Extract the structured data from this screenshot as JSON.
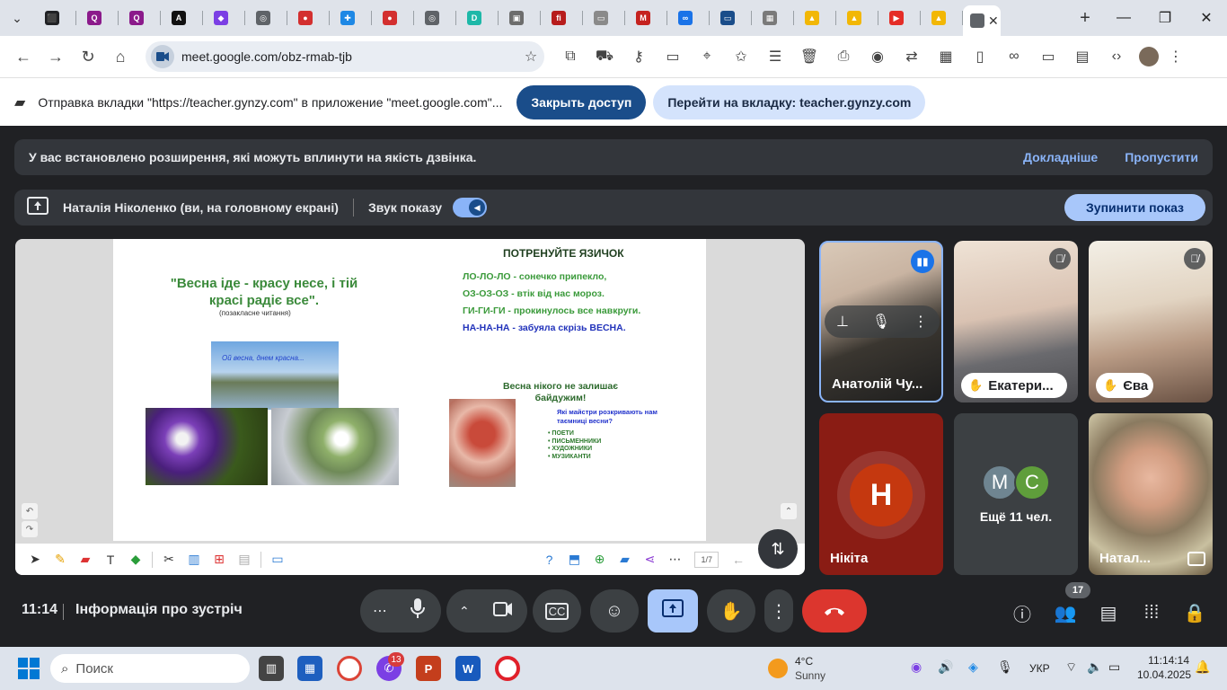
{
  "browser": {
    "tabs": [
      {
        "icon": "app-icon",
        "color": "#202124",
        "glyph": "⬛"
      },
      {
        "icon": "quora-icon",
        "color": "#8b1a8b",
        "glyph": "Q"
      },
      {
        "icon": "quora-icon",
        "color": "#8b1a8b",
        "glyph": "Q"
      },
      {
        "icon": "adobe-icon",
        "color": "#111111",
        "glyph": "A"
      },
      {
        "icon": "shape-icon",
        "color": "#7b3fe4",
        "glyph": "◆"
      },
      {
        "icon": "globe-icon",
        "color": "#5f6368",
        "glyph": "◎"
      },
      {
        "icon": "ball-icon",
        "color": "#d32f2f",
        "glyph": "●"
      },
      {
        "icon": "puzzle-icon",
        "color": "#1e88e5",
        "glyph": "✚"
      },
      {
        "icon": "ball-icon",
        "color": "#d32f2f",
        "glyph": "●"
      },
      {
        "icon": "globe-icon",
        "color": "#5f6368",
        "glyph": "◎"
      },
      {
        "icon": "d-icon",
        "color": "#1db8a8",
        "glyph": "D"
      },
      {
        "icon": "person-icon",
        "color": "#6d6d6d",
        "glyph": "▣"
      },
      {
        "icon": "fi-icon",
        "color": "#b71c1c",
        "glyph": "fi"
      },
      {
        "icon": "whiteboard-icon",
        "color": "#8a8a8a",
        "glyph": "▭"
      },
      {
        "icon": "gmail-icon",
        "color": "#c5221f",
        "glyph": "M"
      },
      {
        "icon": "link-icon",
        "color": "#1a73e8",
        "glyph": "∞"
      },
      {
        "icon": "monitor-icon",
        "color": "#1a4d8a",
        "glyph": "▭"
      },
      {
        "icon": "grid-icon",
        "color": "#7a7a7a",
        "glyph": "▦"
      },
      {
        "icon": "bell-icon",
        "color": "#f2b705",
        "glyph": "▲"
      },
      {
        "icon": "bell-icon",
        "color": "#f2b705",
        "glyph": "▲"
      },
      {
        "icon": "youtube-icon",
        "color": "#e52d27",
        "glyph": "▶"
      },
      {
        "icon": "bell-icon",
        "color": "#f2b705",
        "glyph": "▲"
      }
    ],
    "active_tab_close": "✕",
    "url": "meet.google.com/obz-rmab-tjb"
  },
  "sharebar": {
    "text": "Отправка вкладки \"https://teacher.gynzy.com\" в приложение \"meet.google.com\"...",
    "stop_label": "Закрыть доступ",
    "goto_label": "Перейти на вкладку: teacher.gynzy.com"
  },
  "extension_banner": {
    "text": "У вас встановлено розширення, які можуть вплинути на якість дзвінка.",
    "learn_more": "Докладніше",
    "skip": "Пропустити"
  },
  "presenting_banner": {
    "name": "Наталія Ніколенко (ви, на головному екрані)",
    "sound_label": "Звук показу",
    "stop_label": "Зупинити показ"
  },
  "slide": {
    "left_title": "\"Весна іде - красу несе, і тій красі радіє все\".",
    "left_sub": "(позакласне читання)",
    "lake_caption": "Ой весна, днем красна...",
    "right_title": "ПОТРЕНУЙТЕ ЯЗИЧОК",
    "tongue_twisters": [
      {
        "text": "ЛО-ЛО-ЛО - сонечко припекло,",
        "color": "#3a9a3a"
      },
      {
        "text": "ОЗ-ОЗ-ОЗ - втік від нас мороз.",
        "color": "#3a9a3a"
      },
      {
        "text": "ГИ-ГИ-ГИ - прокинулось все навкруги.",
        "color": "#3a9a3a"
      },
      {
        "text": "НА-НА-НА - забуяла скрізь ВЕСНА.",
        "color": "#2233bb"
      }
    ],
    "spring_note": "Весна нікого не залишає байдужим!",
    "question": "Які майстри розкривають нам таємниці весни?",
    "answers": [
      "ПОЕТИ",
      "ПИСЬМЕННИКИ",
      "ХУДОЖНИКИ",
      "МУЗИКАНТИ"
    ],
    "page_indicator": "1/7"
  },
  "participants": {
    "speaker": {
      "name": "Анатолій Чу..."
    },
    "ekaterina": {
      "name": "Екатери..."
    },
    "eva": {
      "name": "Єва"
    },
    "nikita": {
      "name": "Нікіта",
      "initial": "Н"
    },
    "others": {
      "initials": [
        "М",
        "С"
      ],
      "colors": [
        "#6f8591",
        "#5f9e3b"
      ],
      "label": "Ещё 11 чел."
    },
    "natalia": {
      "name": "Натал..."
    }
  },
  "meetbar": {
    "time": "11:14",
    "meeting_info": "Інформація про зустріч",
    "people_count": "17"
  },
  "taskbar": {
    "search_placeholder": "Поиск",
    "chat_badge": "13",
    "weather_temp": "4°C",
    "weather_desc": "Sunny",
    "lang": "УКР",
    "time": "11:14:14",
    "date": "10.04.2025"
  }
}
